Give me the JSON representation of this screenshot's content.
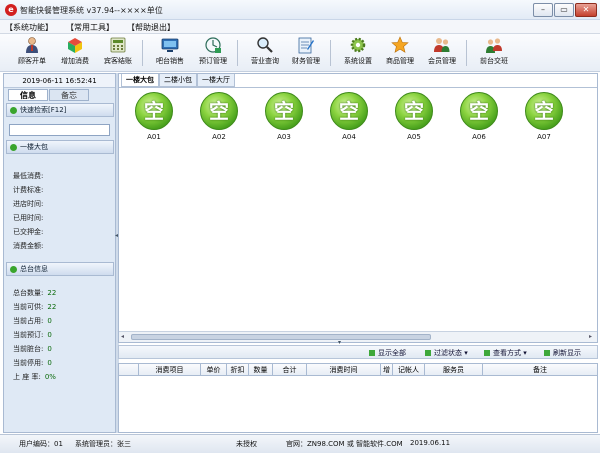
{
  "window": {
    "title": "智能快餐管理系统 v37.94--××××单位",
    "app_icon": "e",
    "min": "–",
    "max": "▭",
    "close": "✕"
  },
  "menu": [
    "【系统功能】",
    "【常用工具】",
    "【帮助退出】"
  ],
  "toolbar": [
    {
      "label": "顾客开单",
      "icon": "customer-icon"
    },
    {
      "label": "增加消费",
      "icon": "add-consume-icon"
    },
    {
      "label": "宾客结账",
      "icon": "checkout-icon"
    },
    {
      "label": "吧台销售",
      "icon": "bar-sale-icon"
    },
    {
      "label": "预订管理",
      "icon": "booking-icon"
    },
    {
      "label": "营业查询",
      "icon": "search-icon"
    },
    {
      "label": "财务管理",
      "icon": "finance-icon"
    },
    {
      "label": "系统设置",
      "icon": "gear-icon"
    },
    {
      "label": "商品管理",
      "icon": "star-icon"
    },
    {
      "label": "会员管理",
      "icon": "member-icon"
    },
    {
      "label": "前台交班",
      "icon": "shift-icon"
    }
  ],
  "left": {
    "datetime": "2019-06-11 16:52:41",
    "tabs": [
      "信息",
      "备忘"
    ],
    "quick_search": "快速检索[F12]",
    "room_section": "一楼大包",
    "room_fields": [
      "最低消费:",
      "计费标准:",
      "进店时间:",
      "已用时间:",
      "已交押金:",
      "消费金额:"
    ],
    "summary_section": "总台信息",
    "summary": [
      {
        "label": "总台数量:",
        "value": "22"
      },
      {
        "label": "当前可供:",
        "value": "22"
      },
      {
        "label": "当前占用:",
        "value": "0"
      },
      {
        "label": "当前预订:",
        "value": "0"
      },
      {
        "label": "当前脏台:",
        "value": "0"
      },
      {
        "label": "当前停用:",
        "value": "0"
      },
      {
        "label": "上 座 率:",
        "value": "0%"
      }
    ]
  },
  "room_tabs": [
    "一楼大包",
    "二楼小包",
    "一楼大厅"
  ],
  "rooms": [
    {
      "state": "空",
      "name": "A01"
    },
    {
      "state": "空",
      "name": "A02"
    },
    {
      "state": "空",
      "name": "A03"
    },
    {
      "state": "空",
      "name": "A04"
    },
    {
      "state": "空",
      "name": "A05"
    },
    {
      "state": "空",
      "name": "A06"
    },
    {
      "state": "空",
      "name": "A07"
    }
  ],
  "actions": [
    "显示全部",
    "过滤状态 ▾",
    "查看方式 ▾",
    "刷新显示"
  ],
  "table_headers": [
    "",
    "消费项目",
    "单价",
    "折扣",
    "数量",
    "合计",
    "消费时间",
    "增",
    "记帐人",
    "服务员",
    "备注"
  ],
  "status": {
    "user": "用户编码：01",
    "manager": "系统管理员：张三",
    "license": "未授权",
    "site": "官网：ZN98.COM 或 智能软件.COM",
    "date": "2019.06.11"
  },
  "colors": {
    "room_free": "#4ca41e",
    "accent": "#3aa52d"
  }
}
